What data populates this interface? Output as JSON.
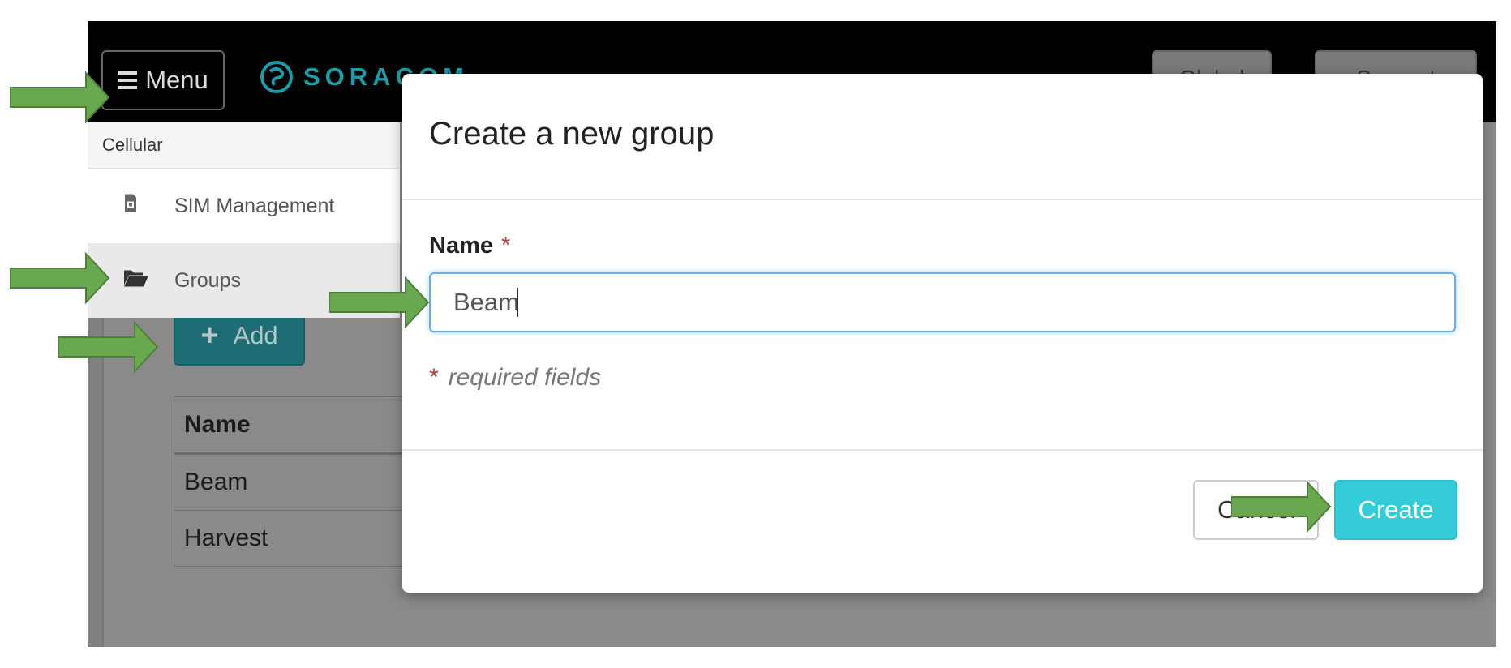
{
  "topbar": {
    "menu_label": "Menu",
    "logo_text": "SORACOM",
    "button_1_label": "Global",
    "button_2_label": "Support"
  },
  "sidebar": {
    "section_header": "Cellular",
    "items": [
      {
        "label": "SIM Management",
        "icon": "sim-card-icon"
      },
      {
        "label": "Groups",
        "icon": "folder-open-icon",
        "active": true
      }
    ]
  },
  "page": {
    "add_label": "Add",
    "table": {
      "header": "Name",
      "rows": [
        "Beam",
        "Harvest"
      ]
    }
  },
  "modal": {
    "title": "Create a new group",
    "name_label": "Name",
    "required_star": "*",
    "name_value": "Beam",
    "required_note": "required fields",
    "cancel_label": "Cancel",
    "create_label": "Create"
  },
  "colors": {
    "accent": "#33ccd8",
    "brand": "#1f9aa6",
    "annotation_arrow": "#6aa84f"
  }
}
